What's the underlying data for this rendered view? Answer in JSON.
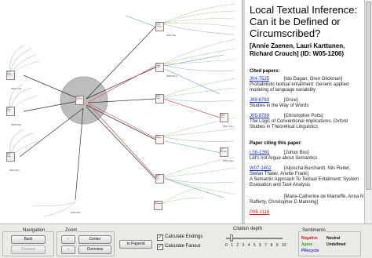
{
  "graph": {
    "nodes": [
      {
        "label": [
          "2001",
          "Learning",
          "to...",
          "..."
        ]
      },
      {
        "label": [
          "2005",
          "Local",
          "Textual",
          "Infer."
        ]
      },
      {
        "label": [
          "2004",
          "Dagan",
          "Prob.",
          "..."
        ]
      },
      {
        "label": [
          "2005",
          "Burch.",
          "Cond.",
          "..."
        ]
      },
      {
        "label": [
          "2007",
          "Zaenen",
          "..."
        ]
      },
      {
        "label": [
          "2008",
          "Bos",
          "Let's",
          "..."
        ]
      },
      {
        "label": [
          "2008",
          "Burch.",
          "Sem.",
          "..."
        ]
      },
      {
        "label": [
          "2007",
          "de",
          "Marneffe",
          "..."
        ]
      },
      {
        "label": [
          "2006",
          "Harabagiu",
          "..."
        ]
      },
      {
        "label": [
          "2003",
          "Grice",
          "Studies",
          "..."
        ]
      },
      {
        "label": [
          "2001",
          "Rev.",
          "Eval",
          "..."
        ]
      },
      {
        "label": [
          "2002",
          "Potts",
          "Logic",
          "..."
        ]
      }
    ],
    "small_labels": [
      "2001 Gris..",
      "2008 Katz",
      "2004 Aho",
      "2001 Brill",
      "2007 Sch..",
      "2009 Sato",
      "2001 Alle",
      "2005 Dina"
    ]
  },
  "paper": {
    "title": "Local Textual Inference: Can it be Defined or Circumscribed?",
    "authors": "[Annie Zaenen, Lauri Karttunen, Richard Crouch] (ID: W05-1206)",
    "cited_header": "Cited papers:",
    "cited": [
      {
        "id": "J04-7525",
        "authors": "[Ido Dagan, Oren Glickman]",
        "title": "Probabilistic textual entailment: Generic applied modeling of language variability"
      },
      {
        "id": "J89-8763",
        "authors": "[Grice]",
        "title": "Studies in the Way of Words"
      },
      {
        "id": "J05-8769",
        "authors": "[Christopher Potts]",
        "title": "The Logic of Conventional Implicatures. Oxford Studies in Theoretical Linguistics"
      }
    ],
    "citing_header": "Paper citing this paper:",
    "citing": [
      {
        "id": "L08-1361",
        "authors": "[Johan Bos]",
        "title": "Let's not Argue about Semantics"
      },
      {
        "id": "W07-1402",
        "authors": "[Aljoscha Burchardt, Nils Reiter, Stefan Thater, Anette Frank]",
        "title": "A Semantic Approach To Textual Entailment: System Evaluation and Task Analysis"
      },
      {
        "id": "",
        "authors": "[Marie-Catherine de Marneffe, Anna N Rafferty, Christopher D Manning]",
        "title": ""
      },
      {
        "id": "P08-1118",
        "authors": "",
        "title": ""
      }
    ]
  },
  "controls": {
    "navigation_label": "Navigation",
    "back_label": "Back",
    "forward_label": "Forward",
    "zoom_label": "Zoom",
    "zoom_in_label": "-",
    "zoom_out_label": "-",
    "center_label": "Center",
    "overview_label": "Overview",
    "to_paperid_label": "to PaperId",
    "calc_endings_label": "Calculate Endings",
    "calc_fanout_label": "Calculate Fanout",
    "citation_depth_label": "Citation depth",
    "depth_ticks": [
      "0",
      "1",
      "2",
      "3",
      "4",
      "5",
      "6",
      "7",
      "8",
      "9",
      "10"
    ],
    "depth_value": 1,
    "sentiments_label": "Sentiments",
    "sentiments": [
      {
        "label": "Negative",
        "color": "#cc2222"
      },
      {
        "label": "Neutral",
        "color": "#111111"
      },
      {
        "label": "Agree",
        "color": "#22aa22"
      },
      {
        "label": "Undefined",
        "color": "#111111"
      },
      {
        "label": "PRecycle",
        "color": "#3333cc"
      }
    ]
  },
  "colors": {
    "link_blue": "#1a33c8",
    "link_red": "#d02020",
    "edge_blue": "#6f97c8",
    "edge_green": "#8fc17f",
    "edge_red": "#d05a5a",
    "focus_circle": "#bdbdbd"
  }
}
